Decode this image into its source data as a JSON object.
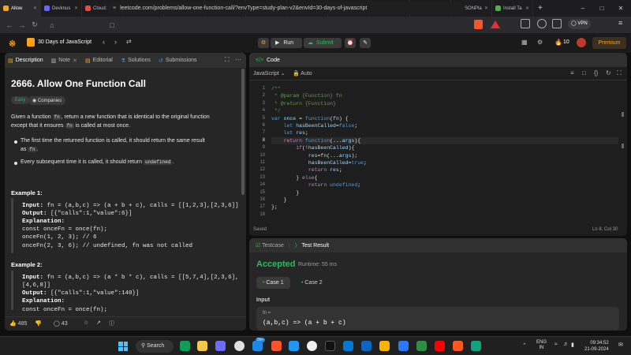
{
  "browser": {
    "tabs": [
      {
        "label": "Allow",
        "color": "#f5a623",
        "active": true
      },
      {
        "label": "Devknus",
        "color": "#6c63ff"
      },
      {
        "label": "Cloud: M",
        "color": "#e74c3c"
      },
      {
        "label": "Student |",
        "color": "#e91e63"
      },
      {
        "label": "Explore D",
        "color": "#e91e63"
      },
      {
        "label": "OpenAI I",
        "color": "#bbbbbb"
      },
      {
        "label": "Dialog -",
        "color": "#4caf50"
      },
      {
        "label": "AlphaDe",
        "color": "#555555"
      },
      {
        "label": "Usage G",
        "color": "#ff9800"
      },
      {
        "label": "v0 by Ve",
        "color": "#ffffff"
      },
      {
        "label": "Log-in to",
        "color": "#2196f3"
      },
      {
        "label": "JSONPla",
        "color": "#cccccc"
      },
      {
        "label": "Install Ta",
        "color": "#4caf50"
      }
    ],
    "url": "leetcode.com/problems/allow-one-function-call/?envType=study-plan-v2&envId=30-days-of-javascript",
    "vpn_label": "VPN"
  },
  "header": {
    "study_plan": "30 Days of JavaScript",
    "run_label": "Run",
    "submit_label": "Submit",
    "streak": "10",
    "premium_label": "Premium"
  },
  "left": {
    "tabs": [
      "Description",
      "Note",
      "Editorial",
      "Solutions",
      "Submissions"
    ],
    "title": "2666. Allow One Function Call",
    "difficulty": "Easy",
    "companies": "Companies",
    "desc_1a": "Given a function",
    "desc_1b": "fn",
    "desc_1c": ", return a new function that is identical to the original function",
    "desc_2a": "except that it ensures",
    "desc_2b": "fn",
    "desc_2c": "is called at most once.",
    "bullet_1a": "The first time the returned function is called, it should return the same result",
    "bullet_1b": "as",
    "bullet_1c": "fn",
    "bullet_1d": ".",
    "bullet_2a": "Every subsequent time it is called, it should return",
    "bullet_2b": "undefined",
    "bullet_2c": ".",
    "ex1_title": "Example 1:",
    "ex1_input_label": "Input:",
    "ex1_input": "fn = (a,b,c) => (a + b + c), calls = [[1,2,3],[2,3,6]]",
    "ex1_output_label": "Output:",
    "ex1_output": "[{\"calls\":1,\"value\":6}]",
    "ex1_expl_label": "Explanation:",
    "ex1_l1": "const onceFn = once(fn);",
    "ex1_l2": "onceFn(1, 2, 3); // 6",
    "ex1_l3": "onceFn(2, 3, 6); // undefined, fn was not called",
    "ex2_title": "Example 2:",
    "ex2_input_label": "Input:",
    "ex2_input": "fn = (a,b,c) => (a * b * c), calls = [[5,7,4],[2,3,6],",
    "ex2_input_b": "[4,6,8]]",
    "ex2_output_label": "Output:",
    "ex2_output": "[{\"calls\":1,\"value\":140}]",
    "ex2_expl_label": "Explanation:",
    "ex2_l1": "const onceFn = once(fn);",
    "likes": "485",
    "comments": "43"
  },
  "code": {
    "panel_title": "Code",
    "language": "JavaScript",
    "auto_label": "Auto",
    "line_numbers": [
      "1",
      "2",
      "3",
      "4",
      "5",
      "6",
      "7",
      "8",
      "9",
      "10",
      "11",
      "12",
      "13",
      "14",
      "15",
      "16",
      "17",
      "18"
    ],
    "saved": "Saved",
    "cursor": "Ln 8, Col 30"
  },
  "test": {
    "testcase_tab": "Testcase",
    "result_tab": "Test Result",
    "status": "Accepted",
    "runtime": "Runtime: 55 ms",
    "case1": "Case 1",
    "case2": "Case 2",
    "input_label": "Input",
    "fn_label": "fn =",
    "fn_value": "(a,b,c) => (a + b + c)"
  },
  "taskbar": {
    "search_label": "Search",
    "lang_1": "ENG",
    "lang_2": "IN",
    "time": "09:34:52",
    "date": "21-09-2024",
    "badge": "99+"
  },
  "colors": {
    "accent_orange": "#ffa116",
    "easy_green": "#00b8a3",
    "accepted_green": "#2cbb5d",
    "premium": "#ffa116"
  }
}
